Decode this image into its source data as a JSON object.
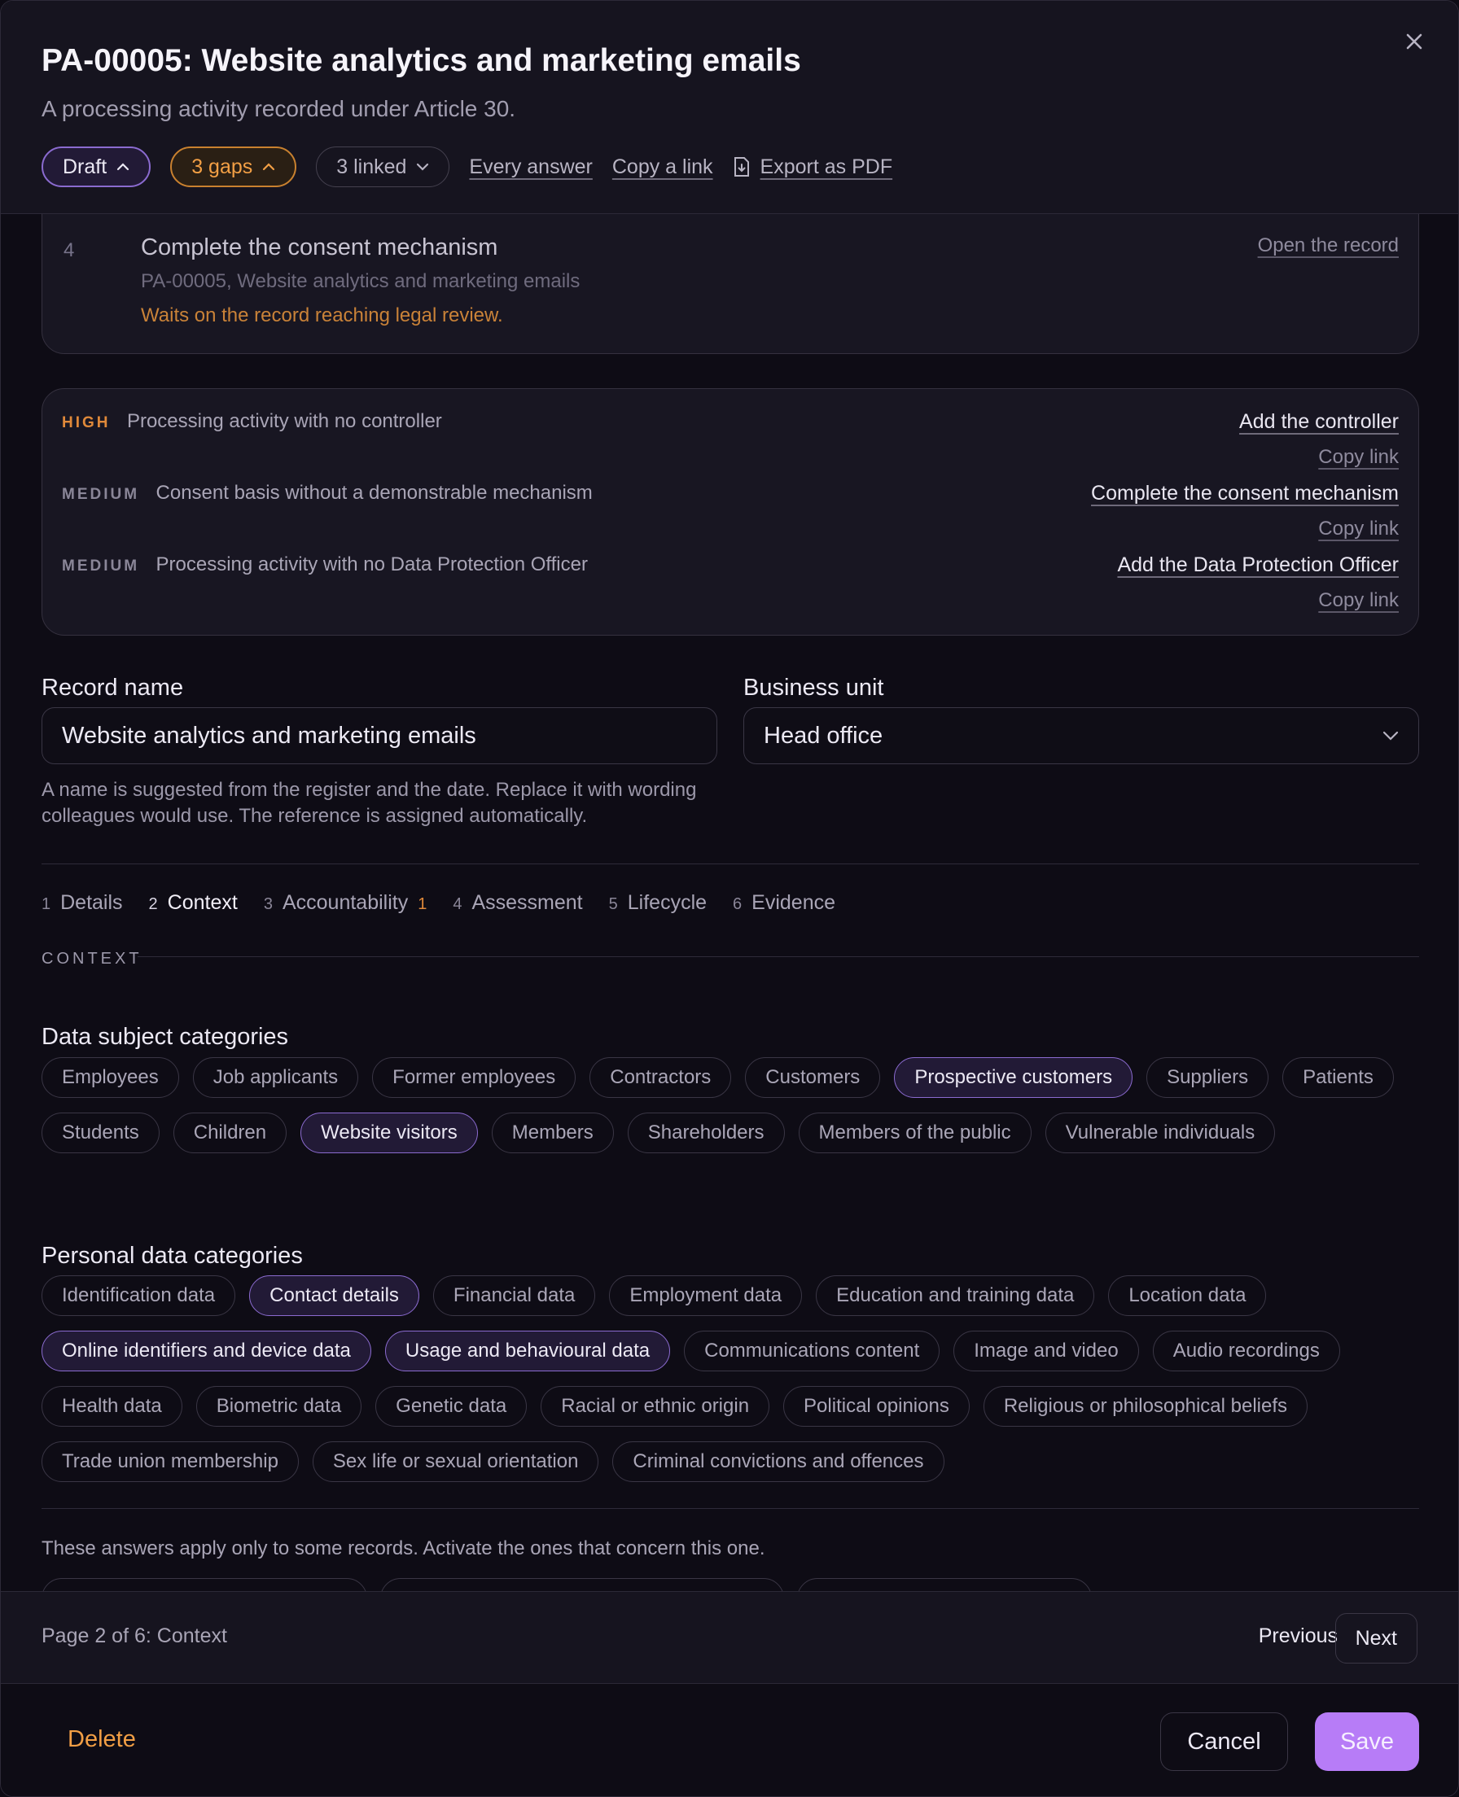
{
  "header": {
    "title": "PA-00005: Website analytics and marketing emails",
    "subtitle": "A processing activity recorded under Article 30.",
    "status_label": "Draft",
    "gaps_label": "3 gaps",
    "linked_label": "3 linked",
    "every_answer": "Every answer",
    "copy_link": "Copy a link",
    "export_pdf": "Export as PDF"
  },
  "steps_card": {
    "number": "4",
    "title": "Complete the consent mechanism",
    "subtitle": "PA-00005, Website analytics and marketing emails",
    "warning": "Waits on the record reaching legal review.",
    "action": "Open the record"
  },
  "gaps": [
    {
      "severity": "HIGH",
      "text": "Processing activity with no controller",
      "action": "Add the controller",
      "copy": "Copy link"
    },
    {
      "severity": "MEDIUM",
      "text": "Consent basis without a demonstrable mechanism",
      "action": "Complete the consent mechanism",
      "copy": "Copy link"
    },
    {
      "severity": "MEDIUM",
      "text": "Processing activity with no Data Protection Officer",
      "action": "Add the Data Protection Officer",
      "copy": "Copy link"
    }
  ],
  "form": {
    "record_name_label": "Record name",
    "record_name_value": "Website analytics and marketing emails",
    "business_unit_label": "Business unit",
    "business_unit_value": "Head office",
    "help_text": "A name is suggested from the register and the date. Replace it with wording colleagues would use. The reference is assigned automatically."
  },
  "tabs": [
    {
      "n": "1",
      "label": "Details",
      "badge": ""
    },
    {
      "n": "2",
      "label": "Context",
      "badge": ""
    },
    {
      "n": "3",
      "label": "Accountability",
      "badge": "1"
    },
    {
      "n": "4",
      "label": "Assessment",
      "badge": ""
    },
    {
      "n": "5",
      "label": "Lifecycle",
      "badge": ""
    },
    {
      "n": "6",
      "label": "Evidence",
      "badge": ""
    }
  ],
  "section_label": "CONTEXT",
  "data_subjects": {
    "title": "Data subject categories",
    "items": [
      {
        "label": "Employees",
        "selected": false
      },
      {
        "label": "Job applicants",
        "selected": false
      },
      {
        "label": "Former employees",
        "selected": false
      },
      {
        "label": "Contractors",
        "selected": false
      },
      {
        "label": "Customers",
        "selected": false
      },
      {
        "label": "Prospective customers",
        "selected": true
      },
      {
        "label": "Suppliers",
        "selected": false
      },
      {
        "label": "Patients",
        "selected": false
      },
      {
        "label": "Students",
        "selected": false
      },
      {
        "label": "Children",
        "selected": false
      },
      {
        "label": "Website visitors",
        "selected": true
      },
      {
        "label": "Members",
        "selected": false
      },
      {
        "label": "Shareholders",
        "selected": false
      },
      {
        "label": "Members of the public",
        "selected": false
      },
      {
        "label": "Vulnerable individuals",
        "selected": false
      }
    ]
  },
  "personal_data": {
    "title": "Personal data categories",
    "items": [
      {
        "label": "Identification data",
        "selected": false
      },
      {
        "label": "Contact details",
        "selected": true
      },
      {
        "label": "Financial data",
        "selected": false
      },
      {
        "label": "Employment data",
        "selected": false
      },
      {
        "label": "Education and training data",
        "selected": false
      },
      {
        "label": "Location data",
        "selected": false
      },
      {
        "label": "Online identifiers and device data",
        "selected": true
      },
      {
        "label": "Usage and behavioural data",
        "selected": true
      },
      {
        "label": "Communications content",
        "selected": false
      },
      {
        "label": "Image and video",
        "selected": false
      },
      {
        "label": "Audio recordings",
        "selected": false
      },
      {
        "label": "Health data",
        "selected": false
      },
      {
        "label": "Biometric data",
        "selected": false
      },
      {
        "label": "Genetic data",
        "selected": false
      },
      {
        "label": "Racial or ethnic origin",
        "selected": false
      },
      {
        "label": "Political opinions",
        "selected": false
      },
      {
        "label": "Religious or philosophical beliefs",
        "selected": false
      },
      {
        "label": "Trade union membership",
        "selected": false
      },
      {
        "label": "Sex life or sexual orientation",
        "selected": false
      },
      {
        "label": "Criminal convictions and offences",
        "selected": false
      }
    ]
  },
  "conditional_note": "These answers apply only to some records. Activate the ones that concern this one.",
  "pager": {
    "text": "Page 2 of 6: Context",
    "previous": "Previous",
    "next": "Next"
  },
  "footer": {
    "delete": "Delete",
    "cancel": "Cancel",
    "save": "Save"
  }
}
